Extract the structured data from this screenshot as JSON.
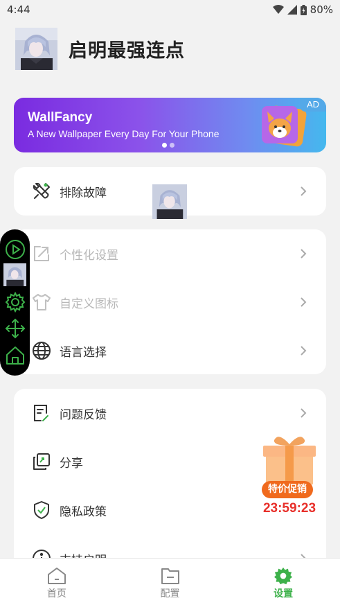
{
  "status_bar": {
    "time": "4:44",
    "battery": "80%"
  },
  "profile": {
    "app_name": "启明最强连点"
  },
  "banner": {
    "title": "WallFancy",
    "subtitle": "A New Wallpaper Every Day For Your Phone",
    "ad_label": "AD"
  },
  "card1": {
    "items": [
      {
        "label": "排除故障",
        "icon": "wrench-screwdriver-icon"
      }
    ]
  },
  "card2": {
    "items": [
      {
        "label": "个性化设置",
        "icon": "external-window-icon",
        "disabled": true
      },
      {
        "label": "自定义图标",
        "icon": "tshirt-icon",
        "disabled": true
      },
      {
        "label": "语言选择",
        "icon": "globe-icon",
        "disabled": false
      }
    ]
  },
  "card3": {
    "items": [
      {
        "label": "问题反馈",
        "icon": "feedback-doc-icon"
      },
      {
        "label": "分享",
        "icon": "share-link-icon"
      },
      {
        "label": "隐私政策",
        "icon": "shield-check-icon"
      },
      {
        "label": "支持启明",
        "icon": "info-icon"
      }
    ]
  },
  "promo": {
    "badge": "特价促销",
    "timer": "23:59:23"
  },
  "bottom_nav": {
    "items": [
      {
        "label": "首页",
        "icon": "home-icon",
        "active": false
      },
      {
        "label": "配置",
        "icon": "folder-icon",
        "active": false
      },
      {
        "label": "设置",
        "icon": "settings-gear-icon",
        "active": true
      }
    ]
  },
  "colors": {
    "accent_green": "#3db14a",
    "promo_red": "#e8302b",
    "banner_start": "#7a2be0",
    "banner_end": "#45b8ee"
  }
}
